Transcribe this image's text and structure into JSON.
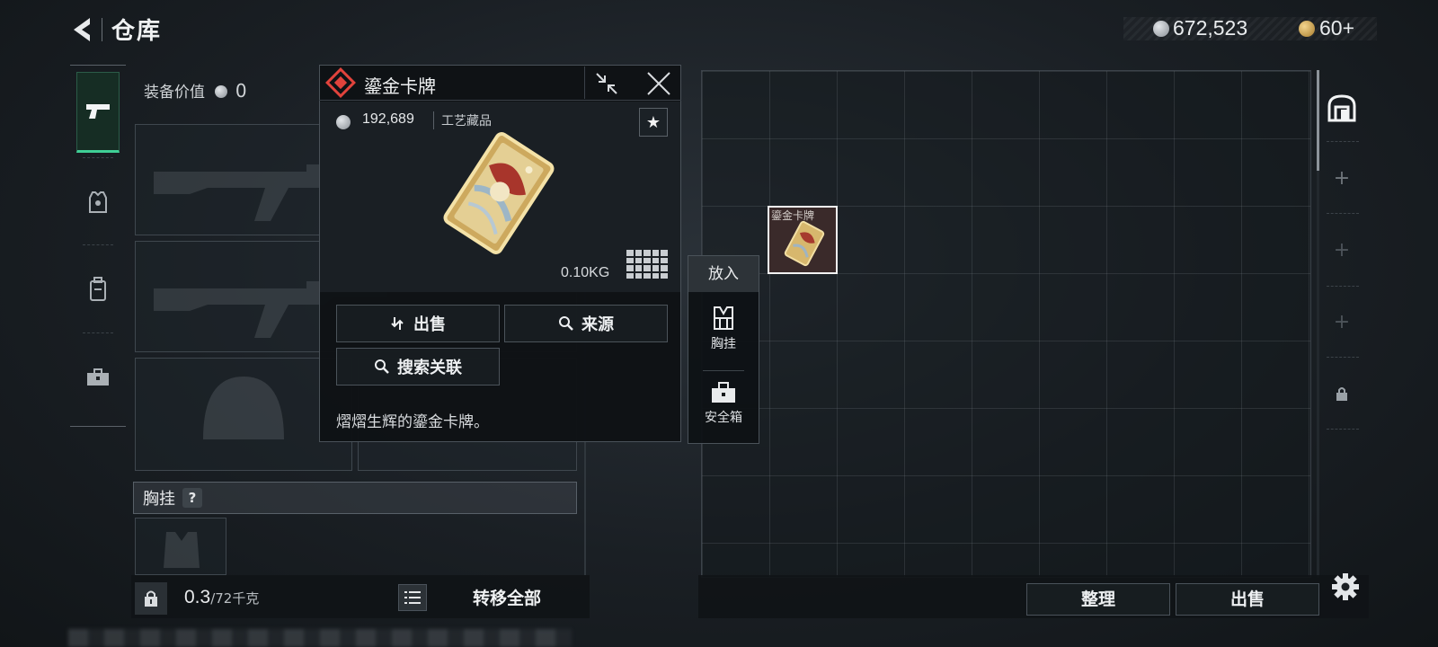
{
  "header": {
    "title": "仓库",
    "money": "672,523",
    "tokens": "60+"
  },
  "equipment": {
    "value_label": "装备价值",
    "value": "0",
    "chest_label": "胸挂",
    "help": "?"
  },
  "footer_left": {
    "weight_current": "0.3",
    "weight_max": "/72千克",
    "transfer_all": "转移全部"
  },
  "popup": {
    "title": "鎏金卡牌",
    "price": "192,689",
    "category": "工艺藏品",
    "weight": "0.10KG",
    "sell_label": "出售",
    "source_label": "来源",
    "search_related_label": "搜索关联",
    "description": "熠熠生辉的鎏金卡牌。",
    "accent_color": "#e1433c"
  },
  "put_in": {
    "header": "放入",
    "items": [
      {
        "label": "胸挂",
        "icon": "chest-rig-icon"
      },
      {
        "label": "安全箱",
        "icon": "safe-box-icon"
      }
    ]
  },
  "storage": {
    "item_label": "鎏金卡牌"
  },
  "footer_right": {
    "sort_label": "整理",
    "sell_label": "出售"
  }
}
